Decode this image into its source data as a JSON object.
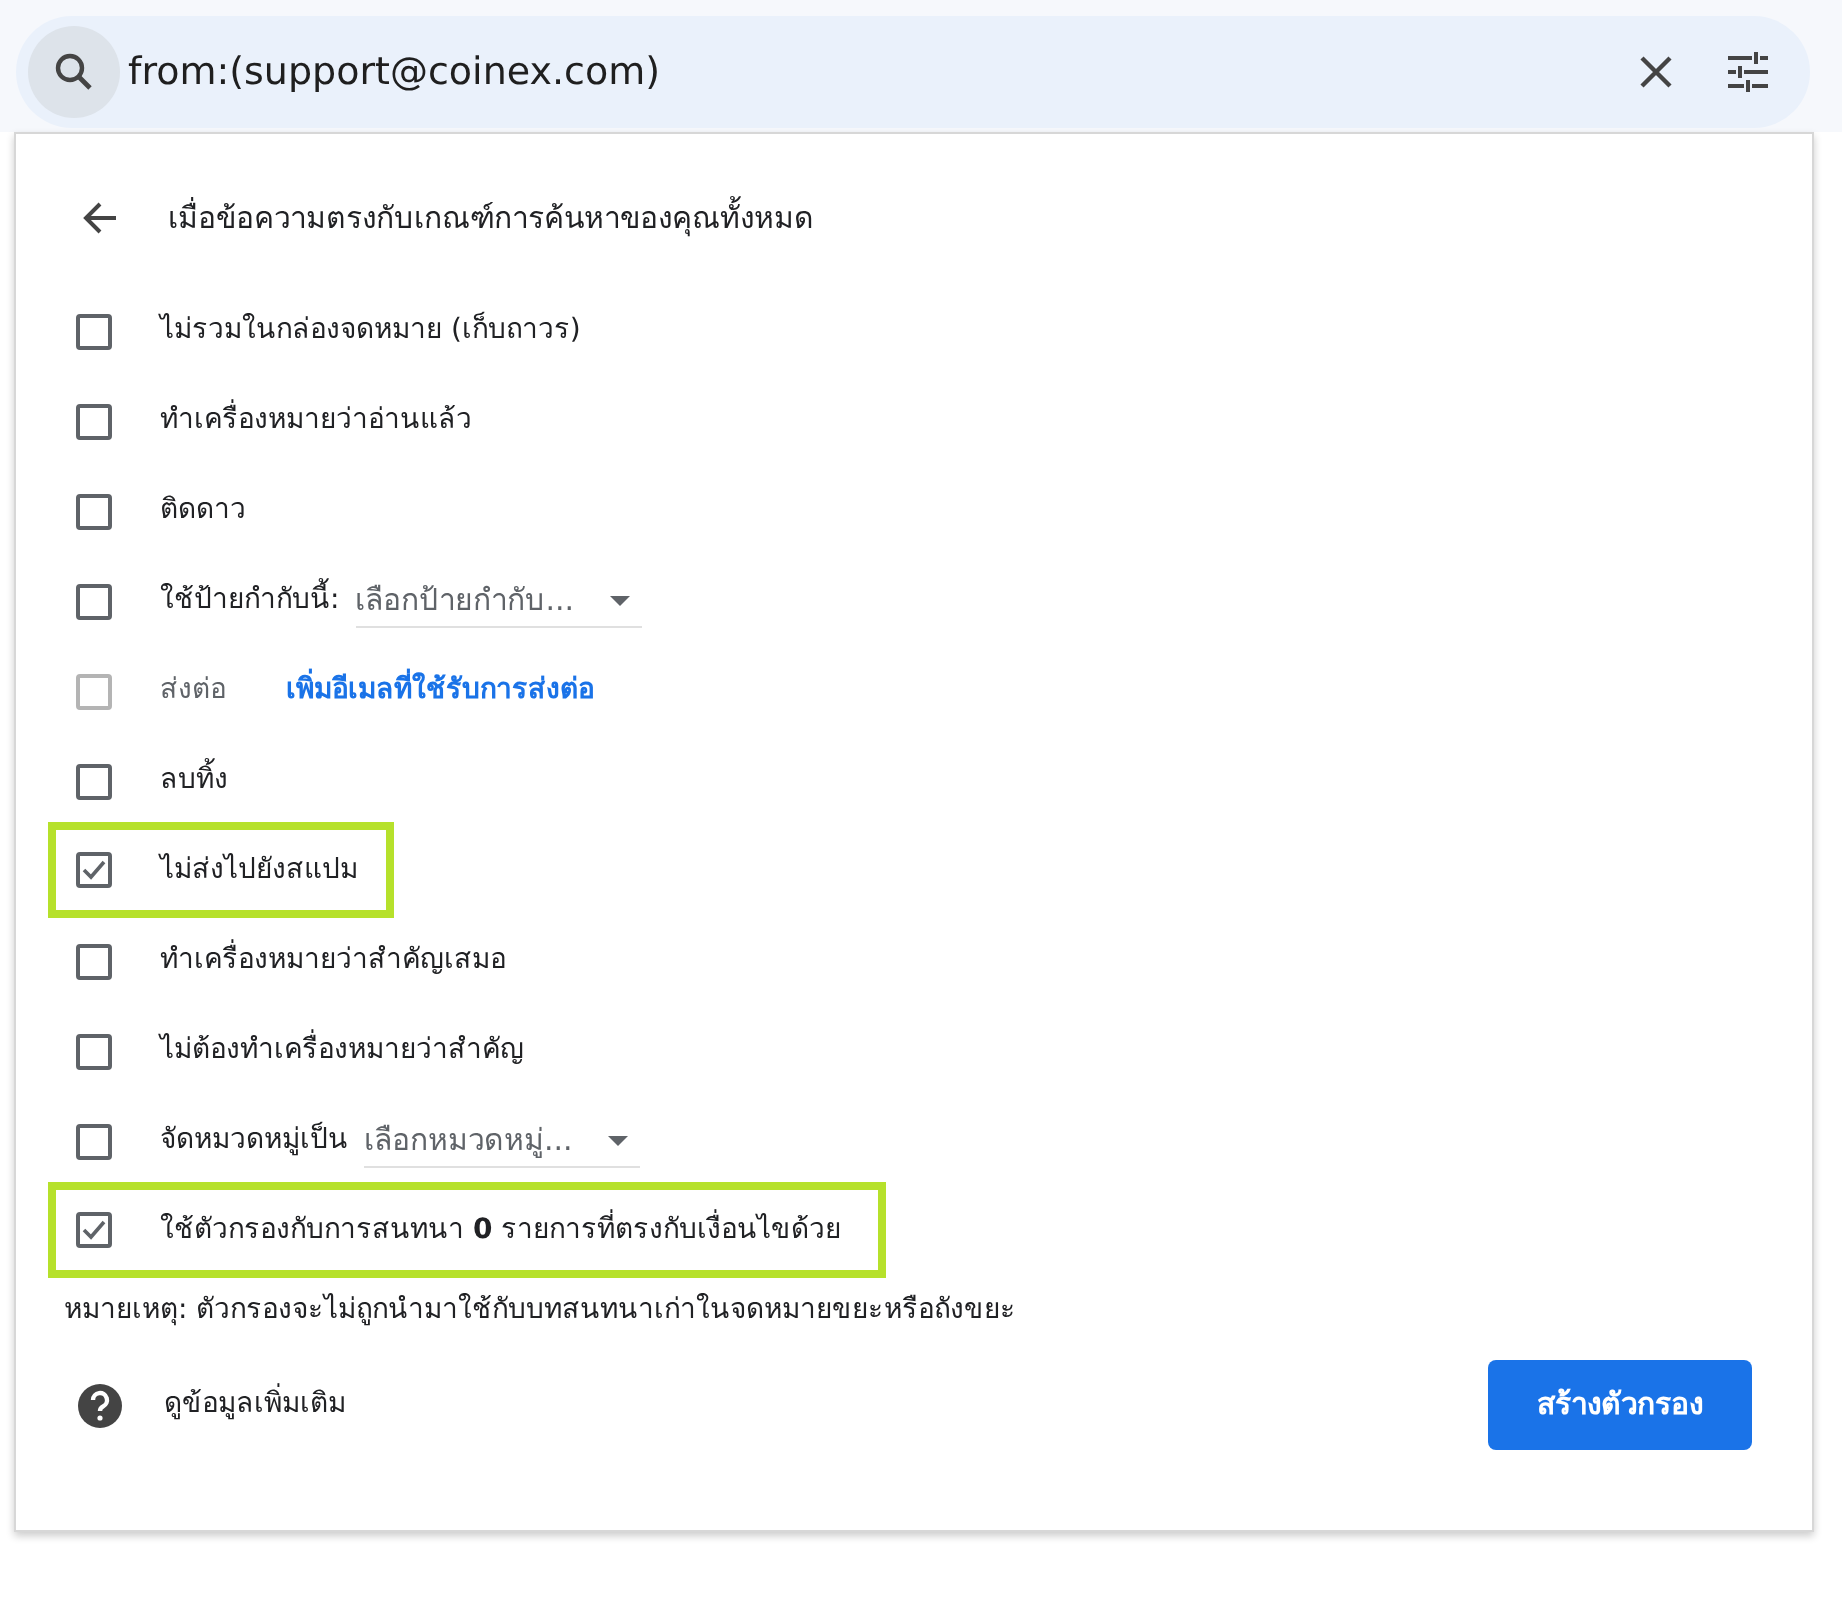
{
  "search": {
    "value": "from:(support@coinex.com)"
  },
  "panel": {
    "heading": "เมื่อข้อความตรงกับเกณฑ์การค้นหาของคุณทั้งหมด",
    "options": [
      {
        "kind": "plain",
        "label": "ไม่รวมในกล่องจดหมาย (เก็บถาวร)",
        "checked": false,
        "disabled": false,
        "highlighted": false
      },
      {
        "kind": "plain",
        "label": "ทำเครื่องหมายว่าอ่านแล้ว",
        "checked": false,
        "disabled": false,
        "highlighted": false
      },
      {
        "kind": "plain",
        "label": "ติดดาว",
        "checked": false,
        "disabled": false,
        "highlighted": false
      },
      {
        "kind": "select",
        "label": "ใช้ป้ายกำกับนี้:",
        "select": "เลือกป้ายกำกับ...",
        "checked": false,
        "disabled": false,
        "highlighted": false
      },
      {
        "kind": "link",
        "label": "ส่งต่อ",
        "link": "เพิ่มอีเมลที่ใช้รับการส่งต่อ",
        "checked": false,
        "disabled": true,
        "highlighted": false
      },
      {
        "kind": "plain",
        "label": "ลบทิ้ง",
        "checked": false,
        "disabled": false,
        "highlighted": false
      },
      {
        "kind": "plain",
        "label": "ไม่ส่งไปยังสแปม",
        "checked": true,
        "disabled": false,
        "highlighted": true
      },
      {
        "kind": "plain",
        "label": "ทำเครื่องหมายว่าสำคัญเสมอ",
        "checked": false,
        "disabled": false,
        "highlighted": false
      },
      {
        "kind": "plain",
        "label": "ไม่ต้องทำเครื่องหมายว่าสำคัญ",
        "checked": false,
        "disabled": false,
        "highlighted": false
      },
      {
        "kind": "select",
        "label": "จัดหมวดหมู่เป็น",
        "select": "เลือกหมวดหมู่...",
        "checked": false,
        "disabled": false,
        "highlighted": false
      },
      {
        "kind": "plain",
        "label": "ใช้ตัวกรองกับการสนทนา **0** รายการที่ตรงกับเงื่อนไขด้วย",
        "checked": true,
        "disabled": false,
        "highlighted": true
      }
    ],
    "note": "หมายเหตุ: ตัวกรองจะไม่ถูกนำมาใช้กับบทสนทนาเก่าในจดหมายขยะหรือถังขยะ",
    "help": "ดูข้อมูลเพิ่มเติม",
    "create_button": "สร้างตัวกรอง"
  }
}
